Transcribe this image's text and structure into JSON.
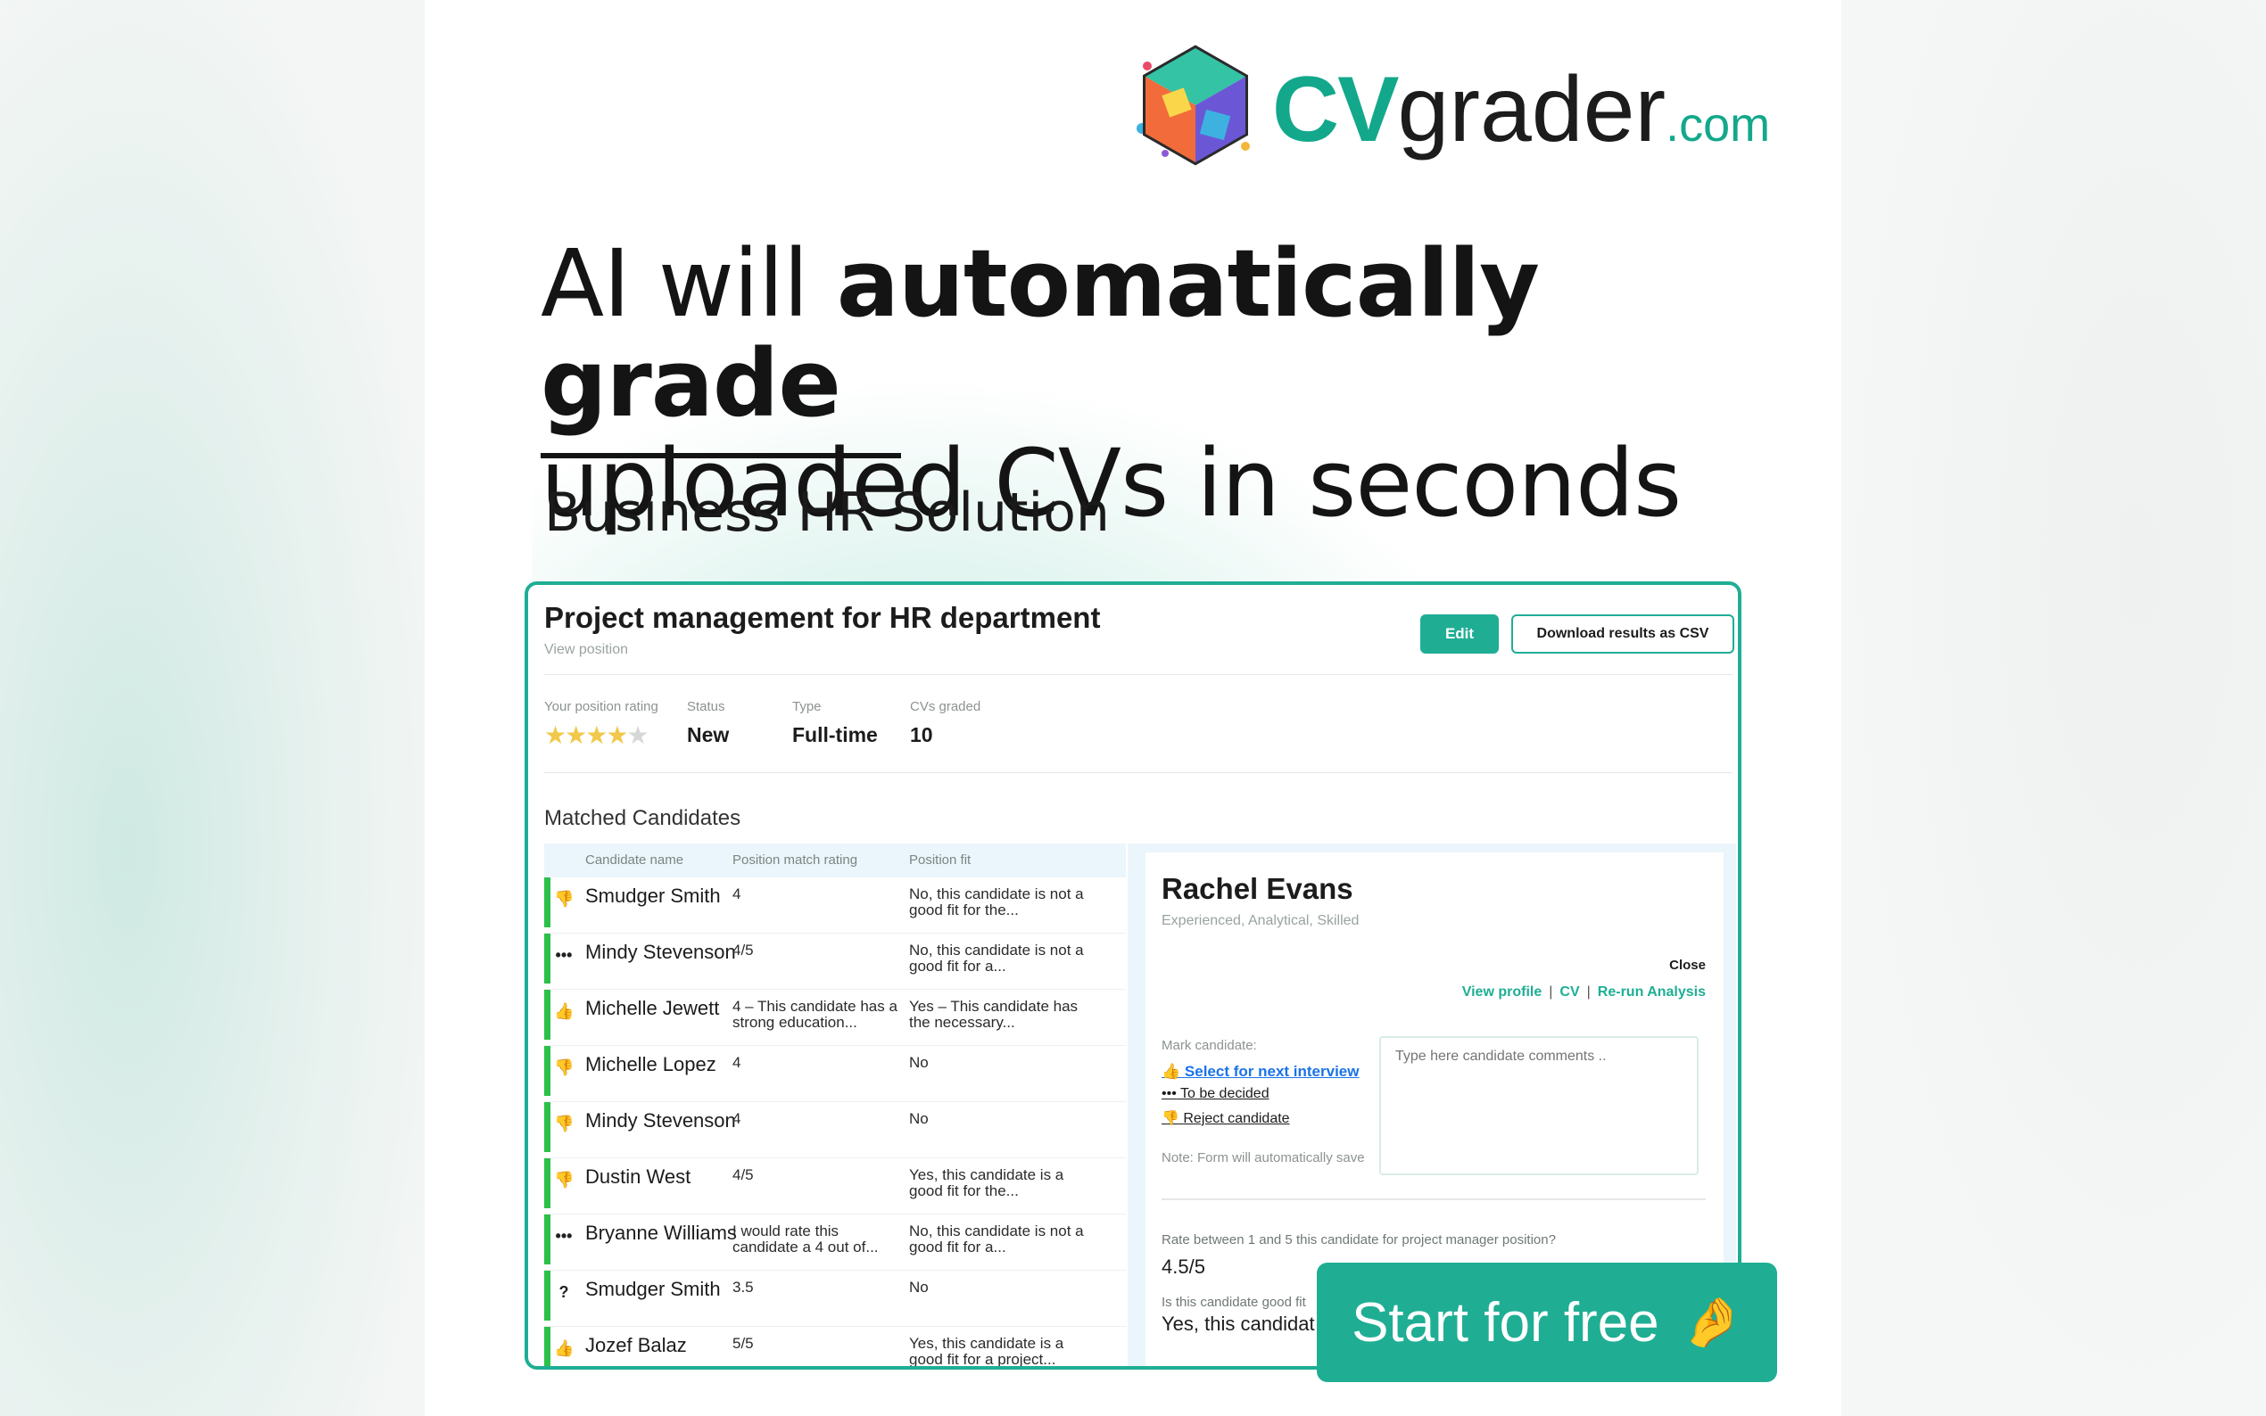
{
  "brand": {
    "cv": "CV",
    "grader": "grader",
    "com": ".com"
  },
  "headline": {
    "part1": "AI will ",
    "bold1": "automatically grade",
    "part2": "uploaded CVs in seconds"
  },
  "subhead": "Business HR Solution",
  "app": {
    "title": "Project management for HR department",
    "view_position": "View position",
    "edit_label": "Edit",
    "csv_label": "Download results as CSV",
    "meta": {
      "rating_label": "Your position rating",
      "rating_value": 4,
      "rating_max": 5,
      "status_label": "Status",
      "status_value": "New",
      "type_label": "Type",
      "type_value": "Full-time",
      "cvs_label": "CVs graded",
      "cvs_value": "10"
    },
    "section_title": "Matched Candidates",
    "table": {
      "headers": [
        "Candidate name",
        "Position match rating",
        "Position fit"
      ],
      "rows": [
        {
          "icon": "thumbs-down",
          "name": "Smudger Smith",
          "rating": "4",
          "fit": "No, this candidate is not a good fit for the..."
        },
        {
          "icon": "more",
          "name": "Mindy Stevenson",
          "rating": "4/5",
          "fit": "No, this candidate is not a good fit for a..."
        },
        {
          "icon": "thumbs-up",
          "name": "Michelle Jewett",
          "rating": "4 – This candidate has a strong education...",
          "fit": "Yes – This candidate has the necessary..."
        },
        {
          "icon": "thumbs-down",
          "name": "Michelle Lopez",
          "rating": "4",
          "fit": "No"
        },
        {
          "icon": "thumbs-down",
          "name": "Mindy Stevenson",
          "rating": "4",
          "fit": "No"
        },
        {
          "icon": "thumbs-down",
          "name": "Dustin West",
          "rating": "4/5",
          "fit": "Yes, this candidate is a good fit for the..."
        },
        {
          "icon": "more",
          "name": "Bryanne Williams",
          "rating": "I would rate this candidate a 4 out of...",
          "fit": "No, this candidate is not a good fit for a..."
        },
        {
          "icon": "question",
          "name": "Smudger Smith",
          "rating": "3.5",
          "fit": "No"
        },
        {
          "icon": "thumbs-up",
          "name": "Jozef Balaz",
          "rating": "5/5",
          "fit": "Yes, this candidate is a good fit for a project..."
        }
      ]
    },
    "detail": {
      "name": "Rachel Evans",
      "tags": "Experienced, Analytical, Skilled",
      "close": "Close",
      "view_profile": "View profile",
      "cv": "CV",
      "rerun": "Re-run Analysis",
      "mark_label": "Mark candidate:",
      "select": "Select for next interview",
      "decide": "To be decided",
      "reject": "Reject candidate",
      "note": "Note: Form will automatically save",
      "comment_placeholder": "Type here candidate comments ..",
      "q1": "Rate between 1 and 5 this candidate for project manager position?",
      "a1": "4.5/5",
      "q2": "Is this candidate good fit",
      "a2": "Yes, this candidat… manager."
    }
  },
  "cta": {
    "label": "Start for free",
    "emoji": "🤌"
  },
  "colors": {
    "accent": "#1fae94",
    "good": "#2cc04a",
    "link": "#1a73e8"
  }
}
